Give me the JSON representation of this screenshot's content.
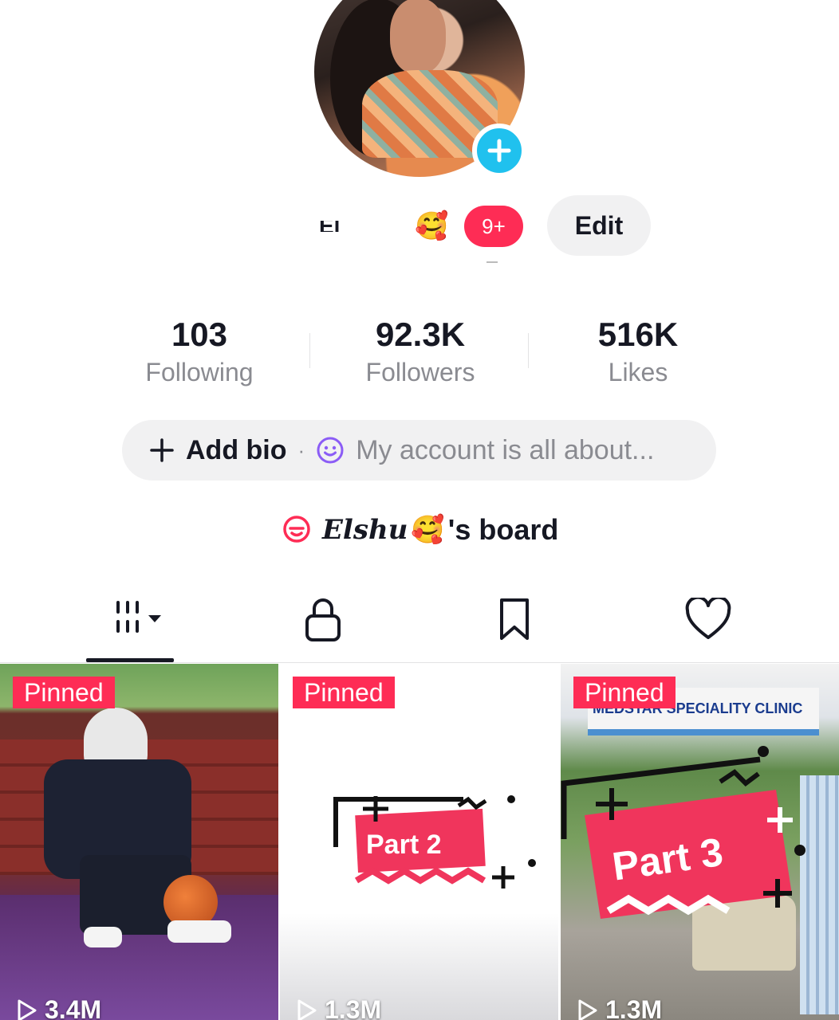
{
  "profile": {
    "name_partial": "El",
    "name_emoji": "🥰",
    "notification_count": "9+",
    "edit_label": "Edit"
  },
  "stats": [
    {
      "value": "103",
      "label": "Following"
    },
    {
      "value": "92.3K",
      "label": "Followers"
    },
    {
      "value": "516K",
      "label": "Likes"
    }
  ],
  "bio": {
    "add_label": "Add bio",
    "separator": "·",
    "placeholder": "My account is all about..."
  },
  "board": {
    "name": "Elshu",
    "emoji": "🥰",
    "suffix": "'s board"
  },
  "tabs": [
    {
      "name": "videos",
      "icon": "grid-bars-icon",
      "active": true
    },
    {
      "name": "private",
      "icon": "lock-icon"
    },
    {
      "name": "saved",
      "icon": "bookmark-icon"
    },
    {
      "name": "liked",
      "icon": "heart-icon"
    }
  ],
  "videos": [
    {
      "pinned_label": "Pinned",
      "views": "3.4M"
    },
    {
      "pinned_label": "Pinned",
      "views": "1.3M",
      "overlay_text": "Part 2"
    },
    {
      "pinned_label": "Pinned",
      "views": "1.3M",
      "overlay_text": "Part 3",
      "sign_text": "MEDSTAR SPECIALITY CLINIC"
    }
  ],
  "colors": {
    "accent": "#fe2c55",
    "add_badge": "#20c1ee",
    "pill_bg": "#f1f1f2",
    "muted_text": "#8a8b91"
  }
}
